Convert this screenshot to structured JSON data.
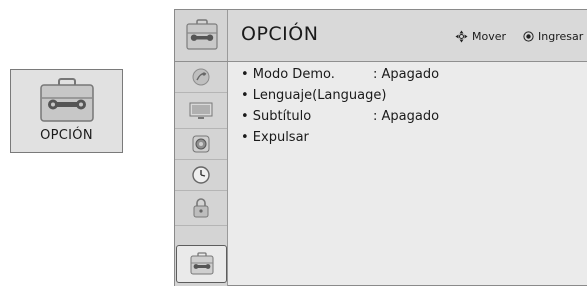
{
  "tile": {
    "label": "OPCIÓN",
    "icon": "toolbox-icon"
  },
  "header": {
    "title": "OPCIÓN",
    "icon": "toolbox-icon",
    "hint_move": "Mover",
    "hint_enter": "Ingresar"
  },
  "sidebar": [
    {
      "icon": "satellite-dish-icon",
      "active": false
    },
    {
      "icon": "tv-screen-icon",
      "active": false
    },
    {
      "icon": "speaker-icon",
      "active": false
    },
    {
      "icon": "clock-icon",
      "active": false
    },
    {
      "icon": "lock-icon",
      "active": false
    },
    {
      "icon": "toolbox-icon",
      "active": true
    }
  ],
  "menu": [
    {
      "label": "• Modo Demo.",
      "value": ": Apagado"
    },
    {
      "label": "• Lenguaje(Language)",
      "value": ""
    },
    {
      "label": "• Subtítulo",
      "value": ": Apagado"
    },
    {
      "label": "• Expulsar",
      "value": ""
    }
  ]
}
